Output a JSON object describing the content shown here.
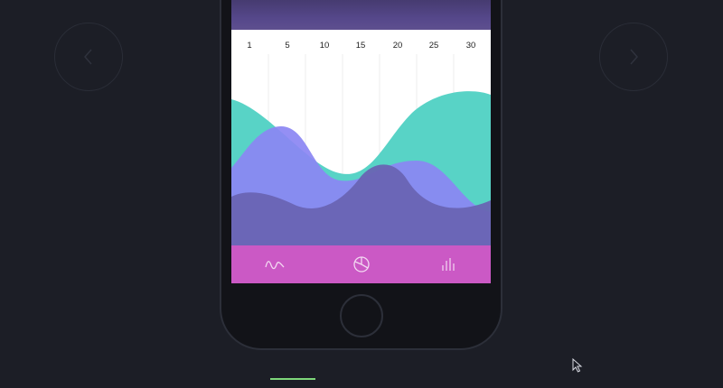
{
  "nav": {
    "prev_icon": "chevron-left-icon",
    "next_icon": "chevron-right-icon"
  },
  "chart_data": {
    "type": "area",
    "x_ticks": [
      "1",
      "5",
      "10",
      "15",
      "20",
      "25",
      "30"
    ],
    "series": [
      {
        "color": "#58d3c6"
      },
      {
        "color": "#8b86f3"
      },
      {
        "color": "#6964b3"
      }
    ]
  },
  "tabs": [
    {
      "icon": "wave-icon"
    },
    {
      "icon": "pie-chart-icon"
    },
    {
      "icon": "bar-chart-icon"
    }
  ],
  "colors": {
    "background": "#1c1e26",
    "tabbar": "#cb59c5",
    "indicator": "#7ed77a"
  }
}
